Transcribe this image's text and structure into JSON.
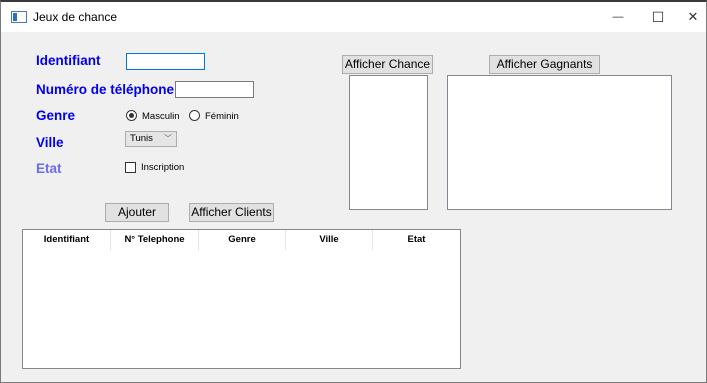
{
  "window": {
    "title": "Jeux de chance",
    "minimize_glyph": "—",
    "maximize_glyph": "☐",
    "close_glyph": "✕"
  },
  "form": {
    "identifiant_label": "Identifiant",
    "identifiant_value": "",
    "telephone_label": "Numéro de téléphone",
    "telephone_value": "",
    "genre_label": "Genre",
    "genre_options": [
      "Masculin",
      "Féminin"
    ],
    "genre_selected": "Masculin",
    "ville_label": "Ville",
    "ville_selected": "Tunis",
    "etat_label": "Etat",
    "inscription_label": "Inscription",
    "inscription_checked": false
  },
  "buttons": {
    "ajouter": "Ajouter",
    "afficher_clients": "Afficher Clients",
    "afficher_chance": "Afficher Chance",
    "afficher_gagnants": "Afficher Gagnants"
  },
  "table": {
    "headers": [
      "Identifiant",
      "N° Telephone",
      "Genre",
      "Ville",
      "Etat"
    ],
    "rows": []
  },
  "icons": {
    "app": "app-window-icon",
    "combo_arrow": "chevron-down-icon"
  }
}
